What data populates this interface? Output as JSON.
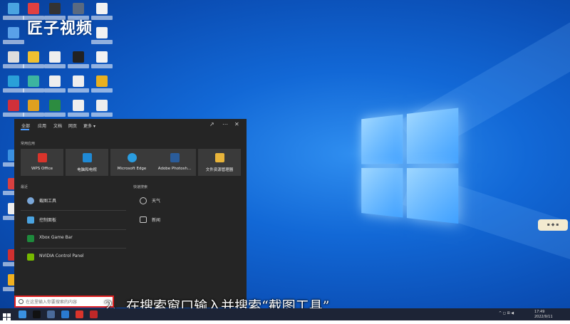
{
  "watermark": {
    "text": "匠子视频"
  },
  "search_panel": {
    "tabs": [
      {
        "label": "全部",
        "active": true
      },
      {
        "label": "应用"
      },
      {
        "label": "文档"
      },
      {
        "label": "网页"
      },
      {
        "label": "更多"
      }
    ],
    "top_apps_heading": "常用应用",
    "top_apps": [
      {
        "label": "WPS Office",
        "icon": "wps-icon",
        "color": "#d9342b"
      },
      {
        "label": "电脑和电视",
        "icon": "media-icon",
        "color": "#1f8ad6"
      },
      {
        "label": "Microsoft Edge",
        "icon": "edge-icon",
        "color": "#2a9de0"
      },
      {
        "label": "Adobe Photosh...",
        "icon": "photoshop-icon",
        "color": "#2a5c9a"
      },
      {
        "label": "文件资源管理器",
        "icon": "folder-icon",
        "color": "#e8b43a"
      }
    ],
    "recent_heading": "最近",
    "recent": [
      {
        "label": "截图工具",
        "icon": "snipping-icon",
        "color": "#7aa7d8"
      },
      {
        "label": "控制面板",
        "icon": "control-panel-icon",
        "color": "#4aa3e0"
      },
      {
        "label": "Xbox Game Bar",
        "icon": "xbox-icon",
        "color": "#1e8a3c"
      },
      {
        "label": "NVIDIA Control Panel",
        "icon": "nvidia-icon",
        "color": "#76b900"
      }
    ],
    "quick_search_heading": "快速搜索",
    "quick_search": [
      {
        "label": "天气",
        "icon": "weather-icon"
      },
      {
        "label": "新闻",
        "icon": "news-icon"
      }
    ]
  },
  "search_box": {
    "placeholder": "在这里输入你要搜索的内容"
  },
  "caption": {
    "text": "2、在搜索窗口输入并搜索“截图工具”"
  },
  "tray": {
    "time": "17:49",
    "date": "2022/9/11"
  },
  "accent_color": "#4a9bff",
  "highlight_color": "#e02020"
}
